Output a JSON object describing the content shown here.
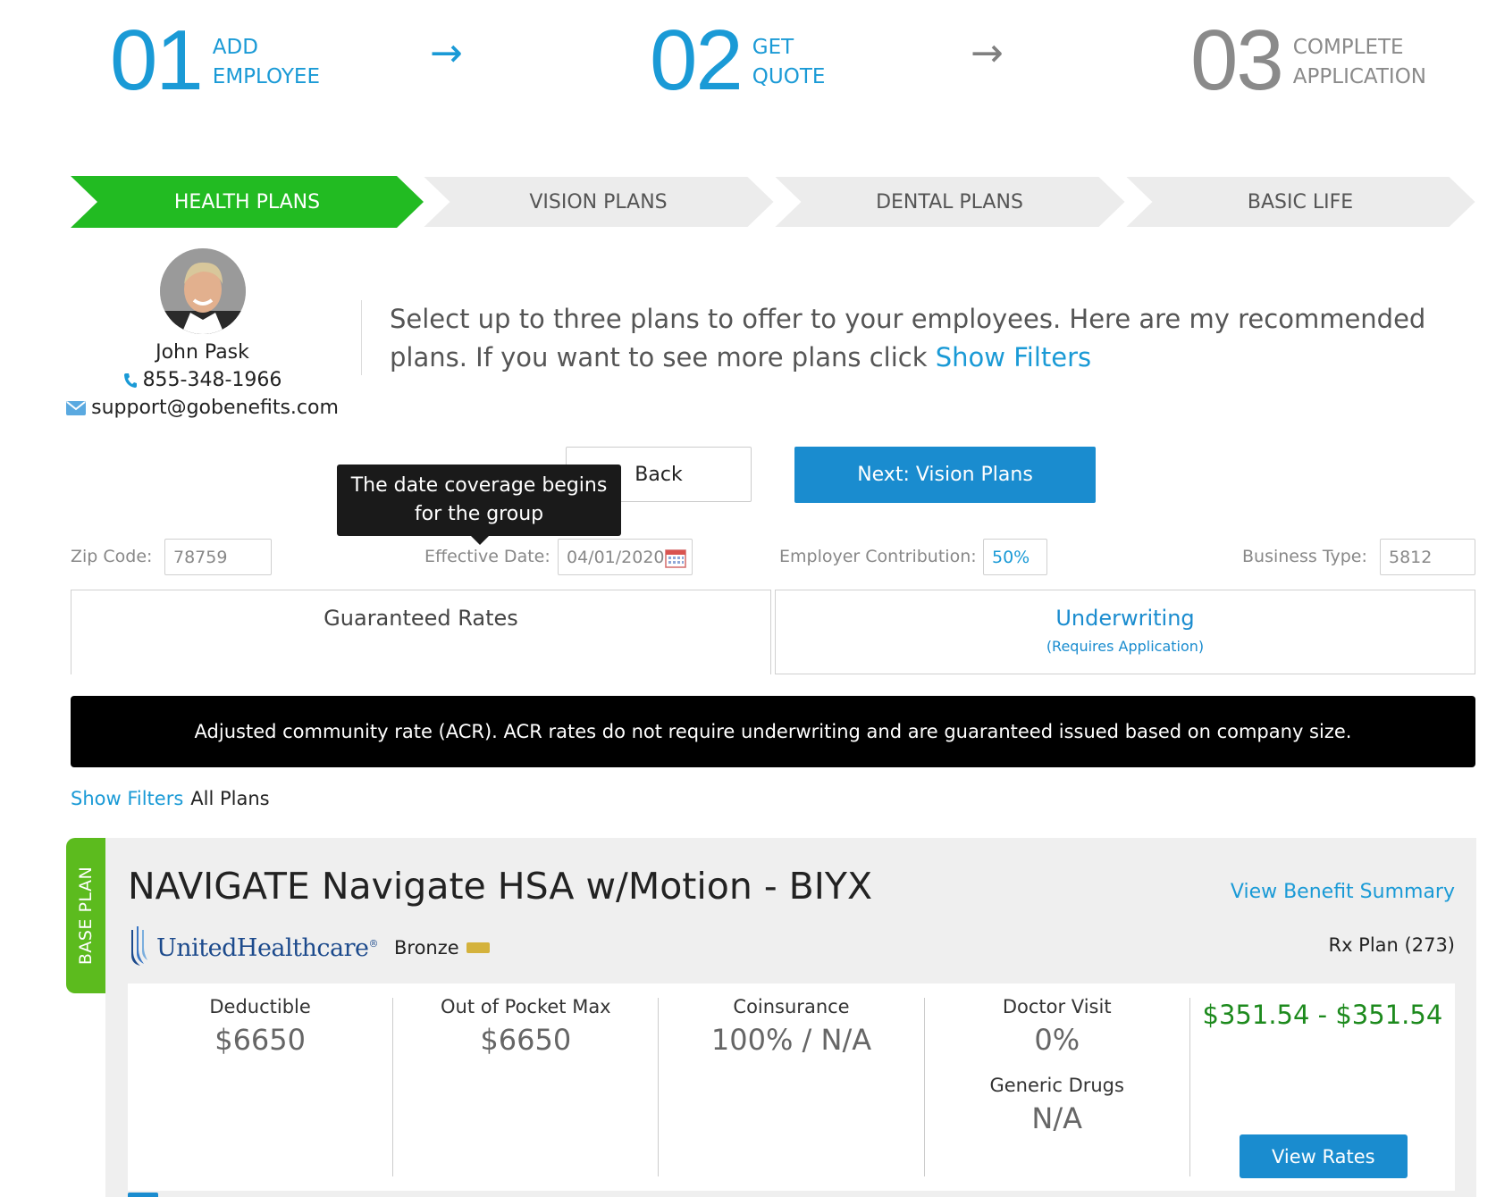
{
  "steps": [
    {
      "number": "01",
      "label_line1": "ADD",
      "label_line2": "EMPLOYEE",
      "state": "active"
    },
    {
      "number": "02",
      "label_line1": "GET",
      "label_line2": "QUOTE",
      "state": "active"
    },
    {
      "number": "03",
      "label_line1": "COMPLETE",
      "label_line2": "APPLICATION",
      "state": "inactive"
    }
  ],
  "step_arrow": "→",
  "plan_tabs": [
    {
      "label": "HEALTH PLANS",
      "active": true
    },
    {
      "label": "VISION PLANS",
      "active": false
    },
    {
      "label": "DENTAL PLANS",
      "active": false
    },
    {
      "label": "BASIC LIFE",
      "active": false
    }
  ],
  "agent": {
    "name": "John Pask",
    "phone": "855-348-1966",
    "email": "support@gobenefits.com"
  },
  "intro": {
    "text": "Select up to three plans to offer to your employees. Here are my recommended plans. If you want to see more plans click ",
    "link": "Show Filters"
  },
  "buttons": {
    "back": "Back",
    "next": "Next: Vision Plans"
  },
  "tooltip": {
    "line1": "The date coverage begins",
    "line2": "for the group"
  },
  "filters": {
    "zip_label": "Zip Code:",
    "zip_value": "78759",
    "effective_label": "Effective Date:",
    "effective_value": "04/01/2020",
    "contribution_label": "Employer Contribution:",
    "contribution_value": "50%",
    "business_label": "Business Type:",
    "business_value": "5812"
  },
  "rate_tabs": {
    "guaranteed": "Guaranteed Rates",
    "underwriting": "Underwriting",
    "underwriting_sub": "(Requires Application)"
  },
  "banner": "Adjusted community rate (ACR). ACR rates do not require underwriting and are guaranteed issued based on company size.",
  "filter_bar": {
    "show_filters": "Show Filters",
    "all_plans": "All Plans"
  },
  "plan": {
    "tag": "BASE PLAN",
    "name": "NAVIGATE Navigate HSA w/Motion - BIYX",
    "benefit_summary": "View Benefit Summary",
    "carrier": "UnitedHealthcare",
    "carrier_mark": "®",
    "metal": "Bronze",
    "metal_color": "#d4b23c",
    "rx": "Rx Plan (273)",
    "deductible_label": "Deductible",
    "deductible_value": "$6650",
    "oop_label": "Out of Pocket Max",
    "oop_value": "$6650",
    "coinsurance_label": "Coinsurance",
    "coinsurance_value": "100% / N/A",
    "doctor_label": "Doctor Visit",
    "doctor_value": "0%",
    "generic_label": "Generic Drugs",
    "generic_value": "N/A",
    "price": "$351.54 - $351.54",
    "view_rates": "View Rates"
  },
  "colors": {
    "accent_blue": "#1a9ad6",
    "button_blue": "#1a8ccf",
    "active_tab_green": "#22bb22",
    "base_tag_green": "#5cbb1e",
    "price_green": "#1d8a1d"
  }
}
